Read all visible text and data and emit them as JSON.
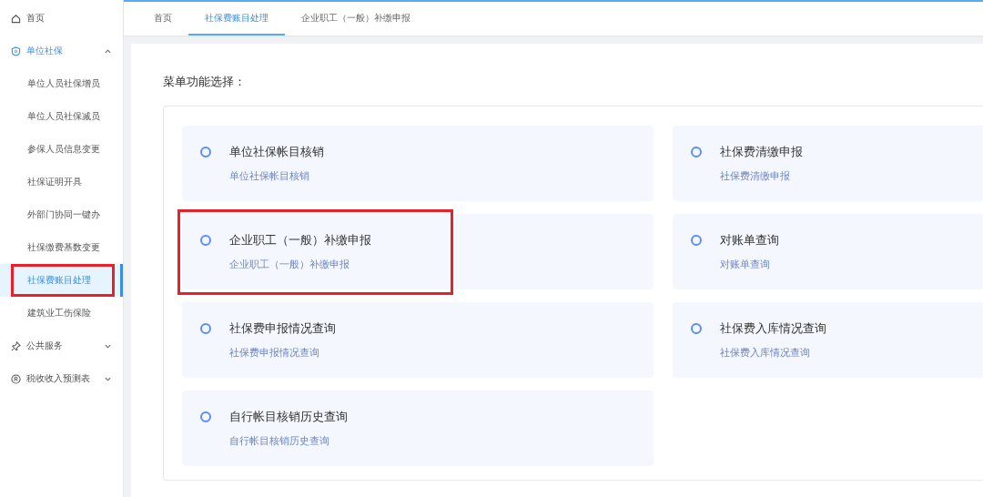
{
  "sidebar": {
    "items": [
      {
        "label": "首页",
        "kind": "link",
        "selected": false
      },
      {
        "label": "单位社保",
        "kind": "group",
        "selected": true,
        "expanded": true,
        "children": [
          {
            "label": "单位人员社保增员",
            "selected": false,
            "highlighted": false
          },
          {
            "label": "单位人员社保减员",
            "selected": false,
            "highlighted": false
          },
          {
            "label": "参保人员信息变更",
            "selected": false,
            "highlighted": false
          },
          {
            "label": "社保证明开具",
            "selected": false,
            "highlighted": false
          },
          {
            "label": "外部门协同一键办",
            "selected": false,
            "highlighted": false
          },
          {
            "label": "社保缴费基数变更",
            "selected": false,
            "highlighted": false
          },
          {
            "label": "社保费账目处理",
            "selected": true,
            "highlighted": true
          },
          {
            "label": "建筑业工伤保险",
            "selected": false,
            "highlighted": false
          }
        ]
      },
      {
        "label": "公共服务",
        "kind": "group",
        "selected": false,
        "expanded": false
      },
      {
        "label": "税收收入预测表",
        "kind": "group",
        "selected": false,
        "expanded": false
      }
    ]
  },
  "tabs": [
    {
      "label": "首页",
      "selected": false
    },
    {
      "label": "社保费账目处理",
      "selected": true
    },
    {
      "label": "企业职工（一般）补缴申报",
      "selected": false
    }
  ],
  "menu": {
    "title": "菜单功能选择：",
    "cards": [
      {
        "title": "单位社保帐目核销",
        "subtitle": "单位社保帐目核销",
        "highlighted": false
      },
      {
        "title": "社保费清缴申报",
        "subtitle": "社保费清缴申报",
        "highlighted": false
      },
      {
        "title": "企业职工（一般）补缴申报",
        "subtitle": "企业职工（一般）补缴申报",
        "highlighted": true
      },
      {
        "title": "对账单查询",
        "subtitle": "对账单查询",
        "highlighted": false
      },
      {
        "title": "社保费申报情况查询",
        "subtitle": "社保费申报情况查询",
        "highlighted": false
      },
      {
        "title": "社保费入库情况查询",
        "subtitle": "社保费入库情况查询",
        "highlighted": false
      },
      {
        "title": "自行帐目核销历史查询",
        "subtitle": "自行帐目核销历史查询",
        "highlighted": false
      }
    ]
  }
}
